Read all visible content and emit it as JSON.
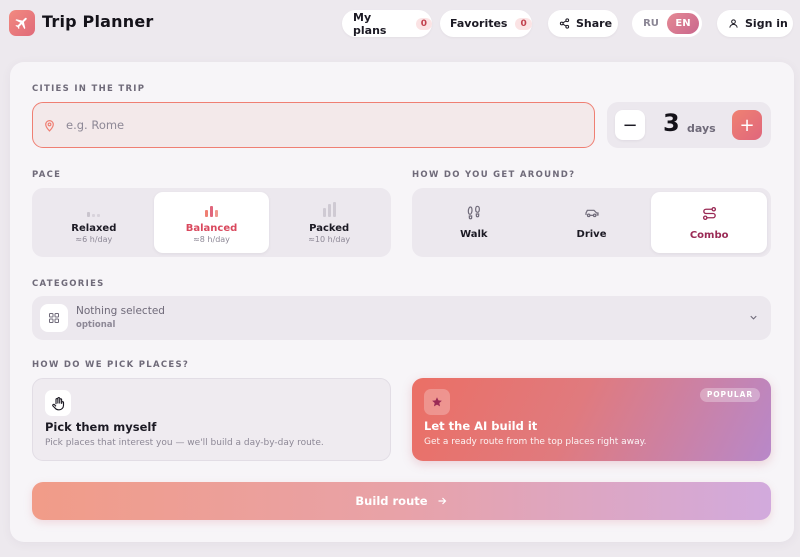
{
  "header": {
    "app_title": "Trip Planner",
    "my_plans_label": "My plans",
    "my_plans_count": "0",
    "favorites_label": "Favorites",
    "favorites_count": "0",
    "share_label": "Share",
    "lang_ru": "RU",
    "lang_en": "EN",
    "active_lang": "EN",
    "sign_in_label": "Sign in"
  },
  "cities": {
    "section_label": "CITIES IN THE TRIP",
    "placeholder": "e.g. Rome",
    "value": "",
    "days_value": "3",
    "days_unit": "days",
    "minus_label": "−",
    "plus_label": "+"
  },
  "pace": {
    "section_label": "PACE",
    "options": [
      {
        "label": "Relaxed",
        "sub": "≈6 h/day",
        "active": false
      },
      {
        "label": "Balanced",
        "sub": "≈8 h/day",
        "active": true
      },
      {
        "label": "Packed",
        "sub": "≈10 h/day",
        "active": false
      }
    ]
  },
  "transport": {
    "section_label": "HOW DO YOU GET AROUND?",
    "options": [
      {
        "label": "Walk",
        "icon": "footprints-icon",
        "active": false
      },
      {
        "label": "Drive",
        "icon": "car-icon",
        "active": false
      },
      {
        "label": "Combo",
        "icon": "route-icon",
        "active": true
      }
    ]
  },
  "categories": {
    "section_label": "CATEGORIES",
    "title": "Nothing selected",
    "subtitle": "optional"
  },
  "pick": {
    "section_label": "HOW DO WE PICK PLACES?",
    "manual": {
      "title": "Pick them myself",
      "desc": "Pick places that interest you — we'll build a day-by-day route."
    },
    "ai": {
      "badge": "POPULAR",
      "title": "Let the AI build it",
      "desc": "Get a ready route from the top places right away."
    }
  },
  "build": {
    "label": "Build route"
  },
  "colors": {
    "accent": "#ef7f73",
    "accent_pink": "#e0667c",
    "wine": "#9a2a55",
    "gradient_end": "#b888c9"
  }
}
